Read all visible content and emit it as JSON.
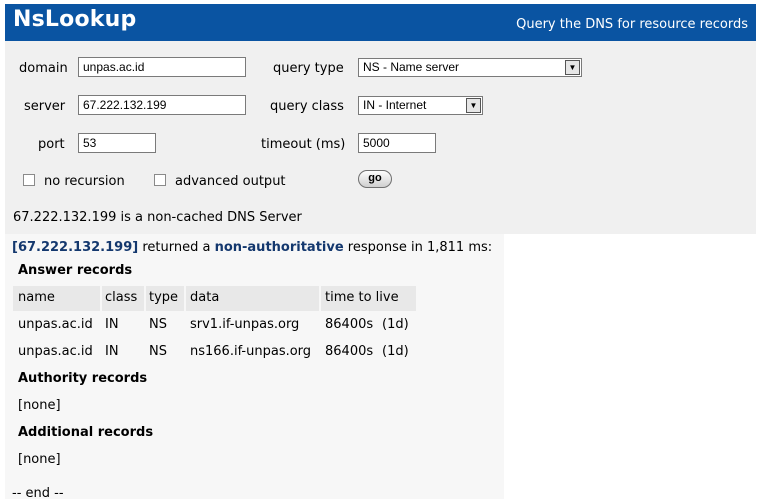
{
  "header": {
    "title": "NsLookup",
    "subtitle": "Query the DNS for resource records"
  },
  "form": {
    "domain_label": "domain",
    "domain_value": "unpas.ac.id",
    "query_type_label": "query type",
    "query_type_value": "NS - Name server",
    "server_label": "server",
    "server_value": "67.222.132.199",
    "query_class_label": "query class",
    "query_class_value": "IN - Internet",
    "port_label": "port",
    "port_value": "53",
    "timeout_label": "timeout (ms)",
    "timeout_value": "5000",
    "no_recursion_label": "no recursion",
    "no_recursion_checked": false,
    "advanced_output_label": "advanced output",
    "advanced_output_checked": false,
    "go_label": "go"
  },
  "status": "67.222.132.199 is a non-cached DNS Server",
  "response": {
    "server": "[67.222.132.199]",
    "text1": " returned a ",
    "auth": "non-authoritative",
    "text2": " response in 1,811 ms:"
  },
  "answer": {
    "title": "Answer records",
    "headers": [
      "name",
      "class",
      "type",
      "data",
      "time to live"
    ],
    "rows": [
      [
        "unpas.ac.id",
        "IN",
        "NS",
        "srv1.if-unpas.org",
        "86400s",
        "(1d)"
      ],
      [
        "unpas.ac.id",
        "IN",
        "NS",
        "ns166.if-unpas.org",
        "86400s",
        "(1d)"
      ]
    ]
  },
  "authority": {
    "title": "Authority records",
    "none": "[none]"
  },
  "additional": {
    "title": "Additional records",
    "none": "[none]"
  },
  "end": "-- end --",
  "colors": {
    "header_bg": "#0a54a2",
    "form_bg": "#f0f0f0",
    "result_bg": "#f7f7f7",
    "link_blue": "#14386e"
  },
  "icons": {
    "dropdown": "chevron-down-icon"
  }
}
